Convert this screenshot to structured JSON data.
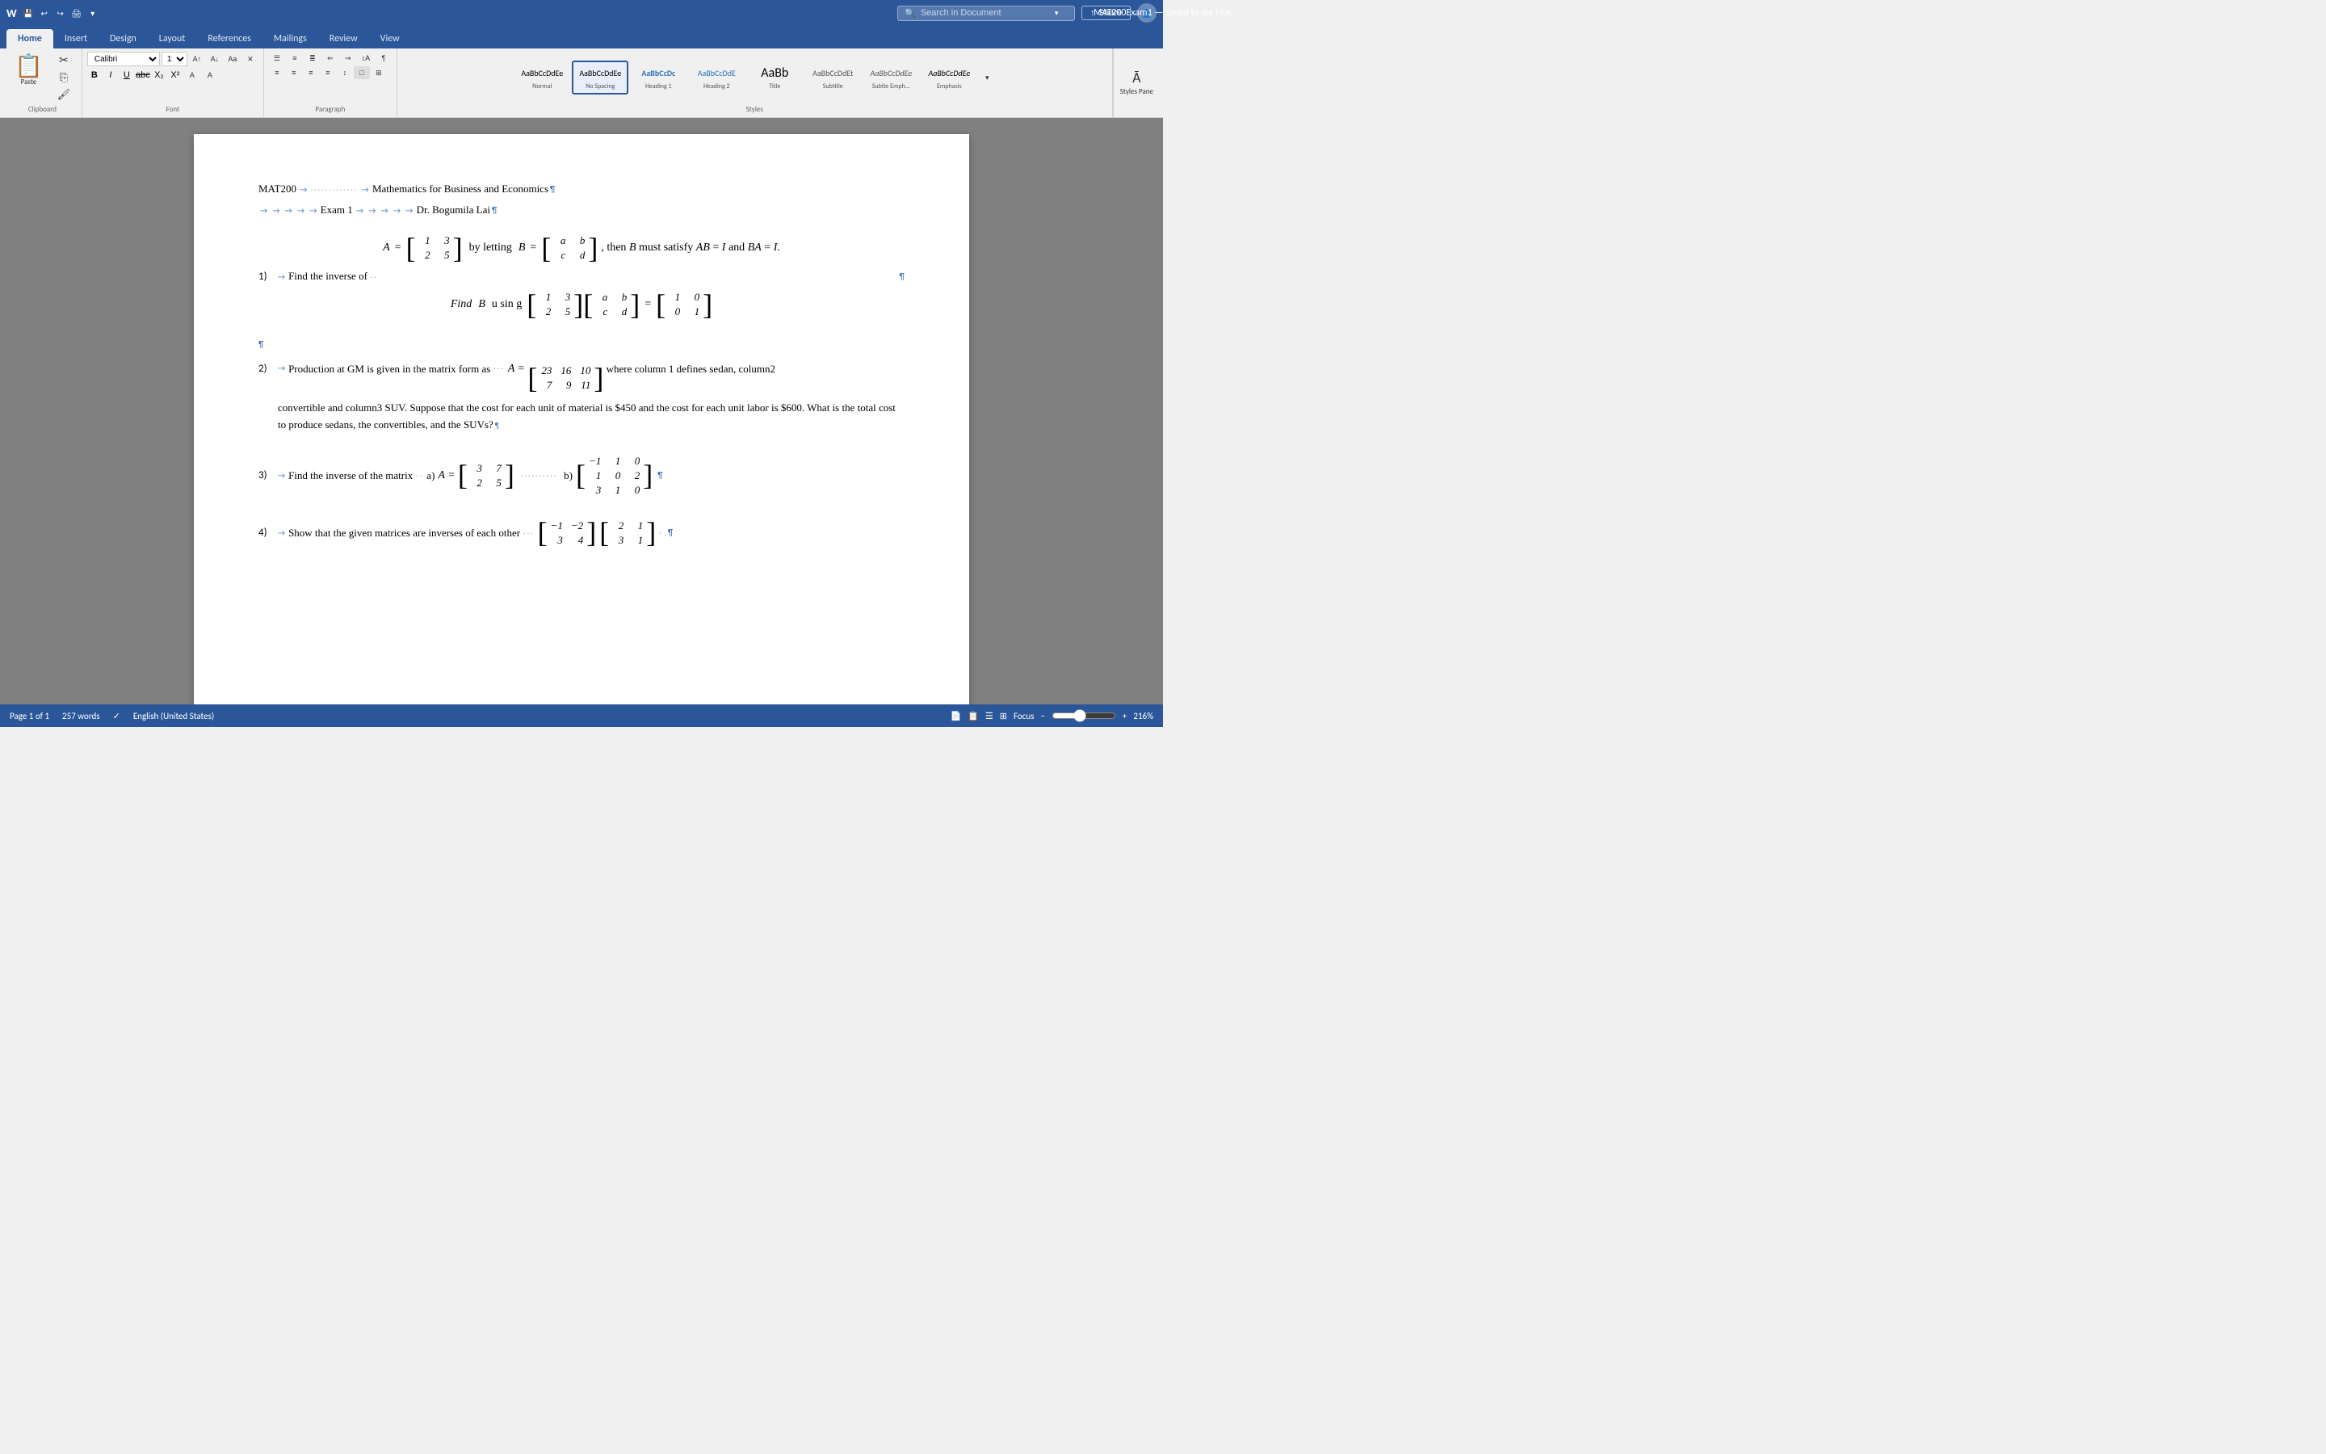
{
  "titlebar": {
    "filename": "MAT200Exam1",
    "saved_status": "Saved to my Mac",
    "search_placeholder": "Search in Document",
    "share_label": "Share"
  },
  "tabs": [
    {
      "label": "Home",
      "active": true
    },
    {
      "label": "Insert",
      "active": false
    },
    {
      "label": "Design",
      "active": false
    },
    {
      "label": "Layout",
      "active": false
    },
    {
      "label": "References",
      "active": false
    },
    {
      "label": "Mailings",
      "active": false
    },
    {
      "label": "Review",
      "active": false
    },
    {
      "label": "View",
      "active": false
    }
  ],
  "ribbon": {
    "paste_label": "Paste",
    "clipboard_label": "Clipboard",
    "font_label": "Font",
    "paragraph_label": "Paragraph",
    "styles_label": "Styles",
    "styles_pane_label": "Styles Pane",
    "bold_label": "B",
    "italic_label": "I",
    "underline_label": "U",
    "styles": [
      {
        "key": "Normal",
        "label": "Normal",
        "preview": "AaBbCcDdEe"
      },
      {
        "key": "NoSpacing",
        "label": "No Spacing",
        "preview": "AaBbCcDdEe",
        "selected": true
      },
      {
        "key": "Heading1",
        "label": "Heading 1",
        "preview": "AaBbCcDc"
      },
      {
        "key": "Heading2",
        "label": "Heading 2",
        "preview": "AaBbCcDdE"
      },
      {
        "key": "Title",
        "label": "Title",
        "preview": "AaBb"
      },
      {
        "key": "Subtitle",
        "label": "Subtitle",
        "preview": "AaBbCcDdEt"
      },
      {
        "key": "SubtleEmph",
        "label": "Subtle Emph...",
        "preview": "AaBbCcDdEe"
      },
      {
        "key": "Emphasis",
        "label": "Emphasis",
        "preview": "AaBbCcDdEe"
      }
    ]
  },
  "document": {
    "header": {
      "course": "MAT200",
      "title": "Mathematics for Business and Economics¶",
      "exam": "Exam 1",
      "instructor": "Dr. Bogumila Lai¶"
    },
    "questions": [
      {
        "num": "1)",
        "text": "Find the inverse of",
        "subtext": "by letting B =",
        "condition": ", then B must satisfy AB = I  and  BA = I.",
        "matrix_A": [
          [
            "1",
            "3"
          ],
          [
            "2",
            "5"
          ]
        ],
        "matrix_B": [
          [
            "a",
            "b"
          ],
          [
            "c",
            "d"
          ]
        ],
        "find_text": "Find   B using",
        "matrix_find1": [
          [
            "1",
            "3"
          ],
          [
            "2",
            "5"
          ]
        ],
        "matrix_find2": [
          [
            "a",
            "b"
          ],
          [
            "c",
            "d"
          ]
        ],
        "matrix_identity": [
          [
            "1",
            "0"
          ],
          [
            "0",
            "1"
          ]
        ]
      },
      {
        "num": "2)",
        "text": "Production at GM is given in the matrix form as",
        "matrix": [
          [
            "23",
            "16",
            "10"
          ],
          [
            "7",
            "9",
            "11"
          ]
        ],
        "after_matrix": "where column 1 defines sedan, column2",
        "continuation": "convertible and column3 SUV. Suppose that the cost for each unit of material is $450 and the cost for each unit labor is $600. What is the total cost to produce sedans, the convertibles, and the SUVs?¶"
      },
      {
        "num": "3)",
        "text": "Find the inverse of the matrix",
        "part_a": "a)",
        "matrix_a": [
          [
            "3",
            "7"
          ],
          [
            "2",
            "5"
          ]
        ],
        "part_b": "b)",
        "matrix_b": [
          [
            "-1",
            "1",
            "0"
          ],
          [
            "1",
            "0",
            "2"
          ],
          [
            "3",
            "1",
            "0"
          ]
        ]
      },
      {
        "num": "4)",
        "text": "Show that the given matrices are inverses of each other",
        "matrix_c": [
          [
            "-1",
            "-2"
          ],
          [
            "3",
            "4"
          ]
        ],
        "matrix_d": [
          [
            "2",
            "1"
          ],
          [
            "3",
            "1"
          ]
        ]
      }
    ]
  },
  "statusbar": {
    "page_info": "Page 1 of 1",
    "word_count": "257 words",
    "language": "English (United States)",
    "view_mode": "Focus",
    "zoom_level": "216%"
  }
}
